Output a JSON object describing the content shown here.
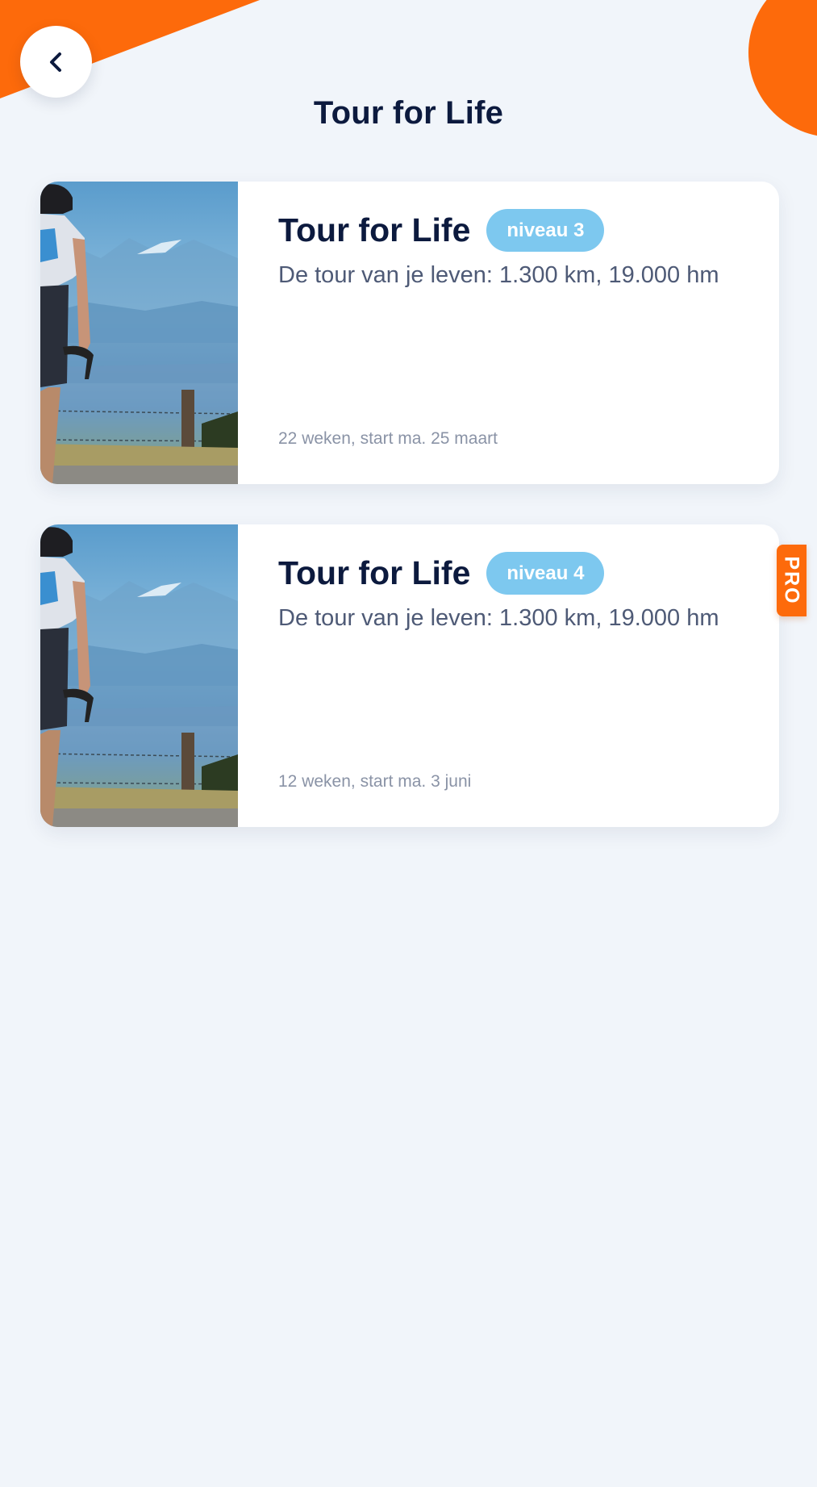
{
  "header": {
    "title": "Tour for Life",
    "back_icon": "chevron-left-icon"
  },
  "cards": [
    {
      "title": "Tour for Life",
      "level": "niveau 3",
      "subtitle": "De tour van je leven: 1.300 km, 19.000 hm",
      "meta": "22 weken, start ma. 25 maart",
      "pro": false
    },
    {
      "title": "Tour for Life",
      "level": "niveau 4",
      "subtitle": "De tour van je leven: 1.300 km, 19.000 hm",
      "meta": "12 weken, start ma. 3 juni",
      "pro": true
    }
  ],
  "pro_label": "PRO",
  "colors": {
    "accent": "#fd6a0b",
    "badge": "#7dc8ef",
    "title": "#0c1a3e",
    "background": "#f1f5fa"
  }
}
